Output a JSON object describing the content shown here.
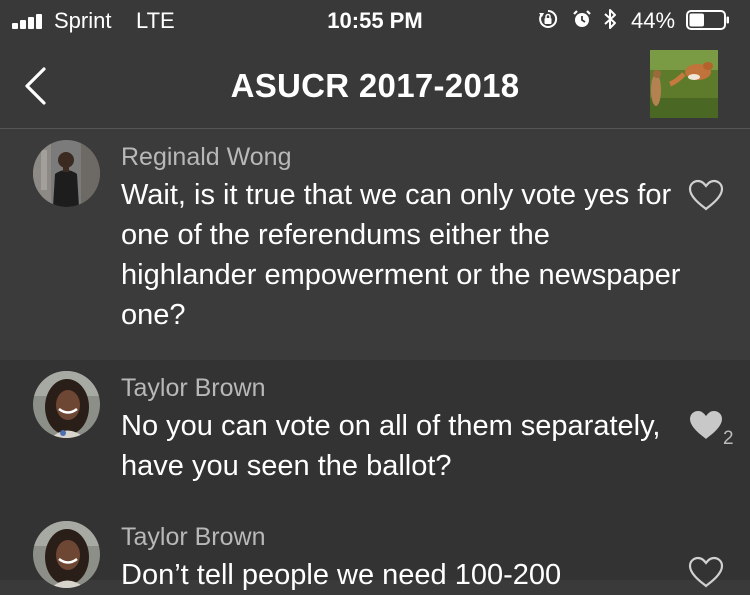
{
  "status_bar": {
    "carrier": "Sprint",
    "network": "LTE",
    "time": "10:55 PM",
    "battery_percent": "44%",
    "battery_level": 0.44,
    "icons": [
      "signal-bars-icon",
      "orientation-lock-icon",
      "alarm-icon",
      "bluetooth-icon",
      "battery-icon"
    ]
  },
  "nav": {
    "title": "ASUCR 2017-2018",
    "back_icon": "chevron-left-icon",
    "thumbnail": "group-photo-fox"
  },
  "messages": [
    {
      "author": "Reginald Wong",
      "text": "Wait, is it true that we can only vote yes for one of the referendums either the highlander empowerment or the newspaper one?",
      "likes": "",
      "liked": false
    },
    {
      "author": "Taylor Brown",
      "text": "No you can vote on all of them separately, have you seen the ballot?",
      "likes": "2",
      "liked": true
    },
    {
      "author": "Taylor Brown",
      "text": "Don’t tell people we need 100-200",
      "likes": "",
      "liked": false
    }
  ],
  "colors": {
    "background": "#3a3a3a",
    "header": "#393939",
    "author_text": "#b8b8b8",
    "heart_outline": "#d0d0d0",
    "heart_filled": "#c8c8c8"
  }
}
